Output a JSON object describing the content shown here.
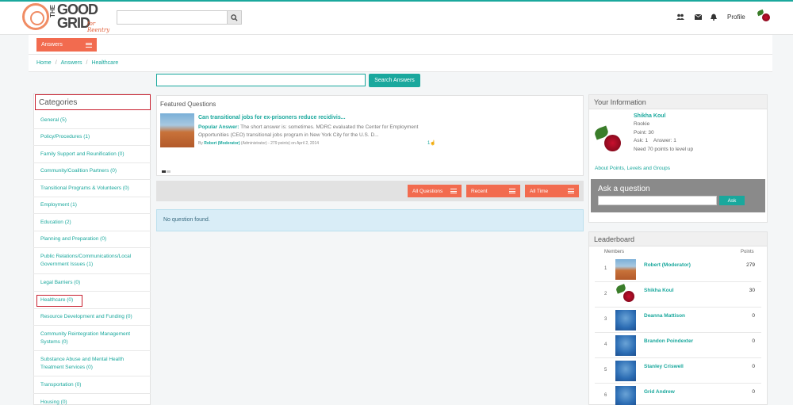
{
  "header": {
    "logo_the": "THE",
    "logo_good": "GOOD",
    "logo_grid": "GRID",
    "logo_reentry": "for Reentry",
    "search_placeholder": "",
    "profile_label": "Profile",
    "icons": [
      "users-icon",
      "mail-icon",
      "bell-icon"
    ]
  },
  "subheader": {
    "answers_label": "Answers"
  },
  "breadcrumb": [
    "Home",
    "Answers",
    "Healthcare"
  ],
  "question_search": {
    "placeholder": "",
    "button_label": "Search Answers"
  },
  "categories": {
    "title": "Categories",
    "items": [
      {
        "label": "General (5)",
        "top": 0
      },
      {
        "label": "Policy/Procedures (1)"
      },
      {
        "label": "Family Support and Reunification (0)"
      },
      {
        "label": "Community/Coalition Partners (0)"
      },
      {
        "label": "Transitional Programs & Volunteers (0)"
      },
      {
        "label": "Employment (1)"
      },
      {
        "label": "Education (2)"
      },
      {
        "label": "Planning and Preparation (0)"
      },
      {
        "label": "Public Relations/Communications/Local Government Issues (1)"
      },
      {
        "label": "Legal Barriers (0)"
      },
      {
        "label": "Healthcare (0)"
      },
      {
        "label": "Resource Development and Funding (0)"
      },
      {
        "label": "Community Reintegration Management Systems (0)"
      },
      {
        "label": "Substance Abuse and Mental Health Treatment Services (0)"
      },
      {
        "label": "Transportation (0)"
      },
      {
        "label": "Housing (0)"
      }
    ]
  },
  "featured": {
    "title": "Featured Questions",
    "question": "Can transitional jobs for ex-prisoners reduce recidivis...",
    "answer_label": "Popular Answer:",
    "answer_text": " The short answer is: sometimes. MDRC evaluated the Center for Employment Opportunities (CEO) transitional jobs program in New York City for the U.S. D...",
    "by_prefix": "By ",
    "by_name": "Robert (Moderator)",
    "by_role": "(Administrator) - 279 points)",
    "by_date": "on April 2, 2014",
    "likes": "1"
  },
  "filters": {
    "all_questions": "All Questions",
    "recent": "Recent",
    "all_time": "All Time"
  },
  "no_questions": "No question found.",
  "your_info": {
    "title": "Your Information",
    "name": "Shikha Koul",
    "rank": "Rookie",
    "points": "Point: 30",
    "ask_answer": "Ask: 1    Answer: 1",
    "level_up": "Need 70 points to level up",
    "about_link": "About Points, Levels and Groups",
    "ask_title": "Ask a question",
    "ask_button": "Ask"
  },
  "leaderboard": {
    "title": "Leaderboard",
    "col_members": "Members",
    "col_points": "Points",
    "rows": [
      {
        "rank": "1",
        "name": "Robert (Moderator)",
        "points": "279",
        "avatar": "rock"
      },
      {
        "rank": "2",
        "name": "Shikha Koul",
        "points": "30",
        "avatar": "rose"
      },
      {
        "rank": "3",
        "name": "Deanna Mattison",
        "points": "0",
        "avatar": "blue"
      },
      {
        "rank": "4",
        "name": "Brandon Poindexter",
        "points": "0",
        "avatar": "blue"
      },
      {
        "rank": "5",
        "name": "Stanley Criswell",
        "points": "0",
        "avatar": "blue"
      },
      {
        "rank": "6",
        "name": "Grid Andrew",
        "points": "0",
        "avatar": "blue"
      }
    ]
  },
  "colors": {
    "accent": "#1aa89d",
    "button": "#f26b4f",
    "highlight_border": "#c8202f"
  }
}
